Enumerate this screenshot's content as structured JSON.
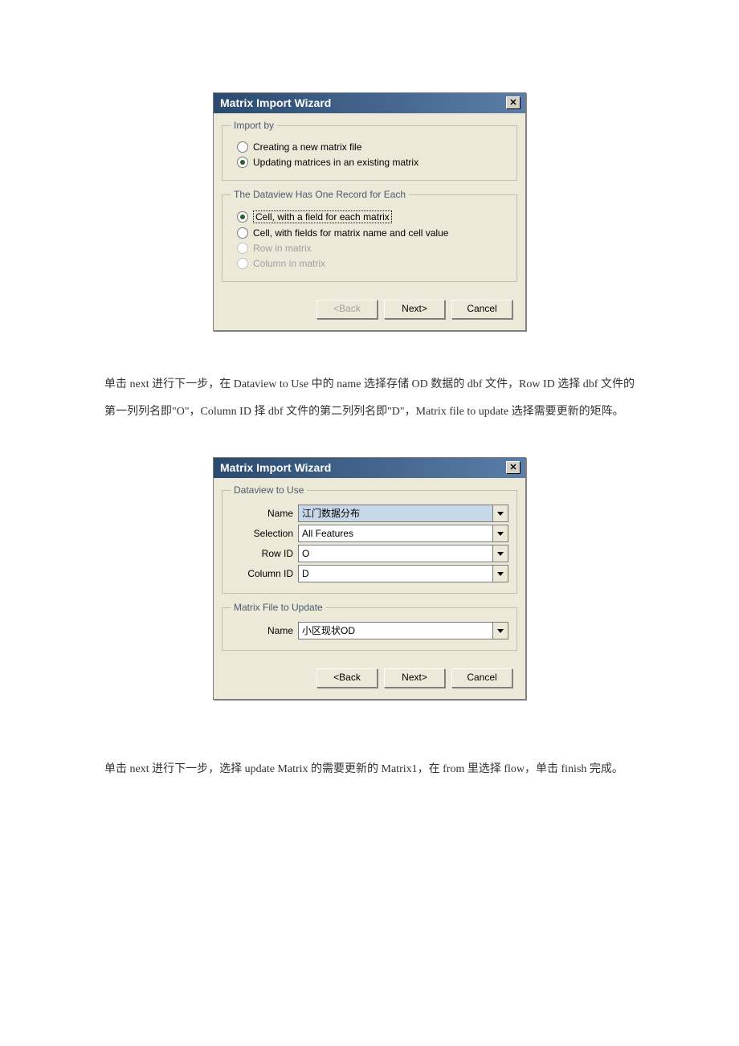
{
  "dialog1": {
    "title": "Matrix Import Wizard",
    "group_import_by": {
      "legend": "Import by",
      "creating": "Creating a new matrix file",
      "updating": "Updating matrices in an existing matrix"
    },
    "group_record": {
      "legend": "The Dataview Has One Record for Each",
      "cell_field": "Cell, with a field for each matrix",
      "cell_name": "Cell, with fields for matrix name and cell value",
      "row": "Row in matrix",
      "col": "Column in matrix"
    },
    "buttons": {
      "back": "<Back",
      "next": "Next>",
      "cancel": "Cancel"
    }
  },
  "para1": "单击 next 进行下一步，在 Dataview to Use 中的 name 选择存储 OD 数据的 dbf 文件，Row ID 选择 dbf 文件的第一列列名即\"O\"，Column ID 择 dbf 文件的第二列列名即\"D\"，Matrix file to update 选择需要更新的矩阵。",
  "dialog2": {
    "title": "Matrix Import Wizard",
    "group_dataview": {
      "legend": "Dataview to Use",
      "name_label": "Name",
      "name_value": "江门数据分布",
      "selection_label": "Selection",
      "selection_value": "All Features",
      "rowid_label": "Row ID",
      "rowid_value": "O",
      "colid_label": "Column ID",
      "colid_value": "D"
    },
    "group_update": {
      "legend": "Matrix File to Update",
      "name_label": "Name",
      "name_value": "小区现状OD"
    },
    "buttons": {
      "back": "<Back",
      "next": "Next>",
      "cancel": "Cancel"
    }
  },
  "para2": "单击 next 进行下一步，选择 update Matrix 的需要更新的 Matrix1，在 from 里选择 flow，单击 finish 完成。"
}
